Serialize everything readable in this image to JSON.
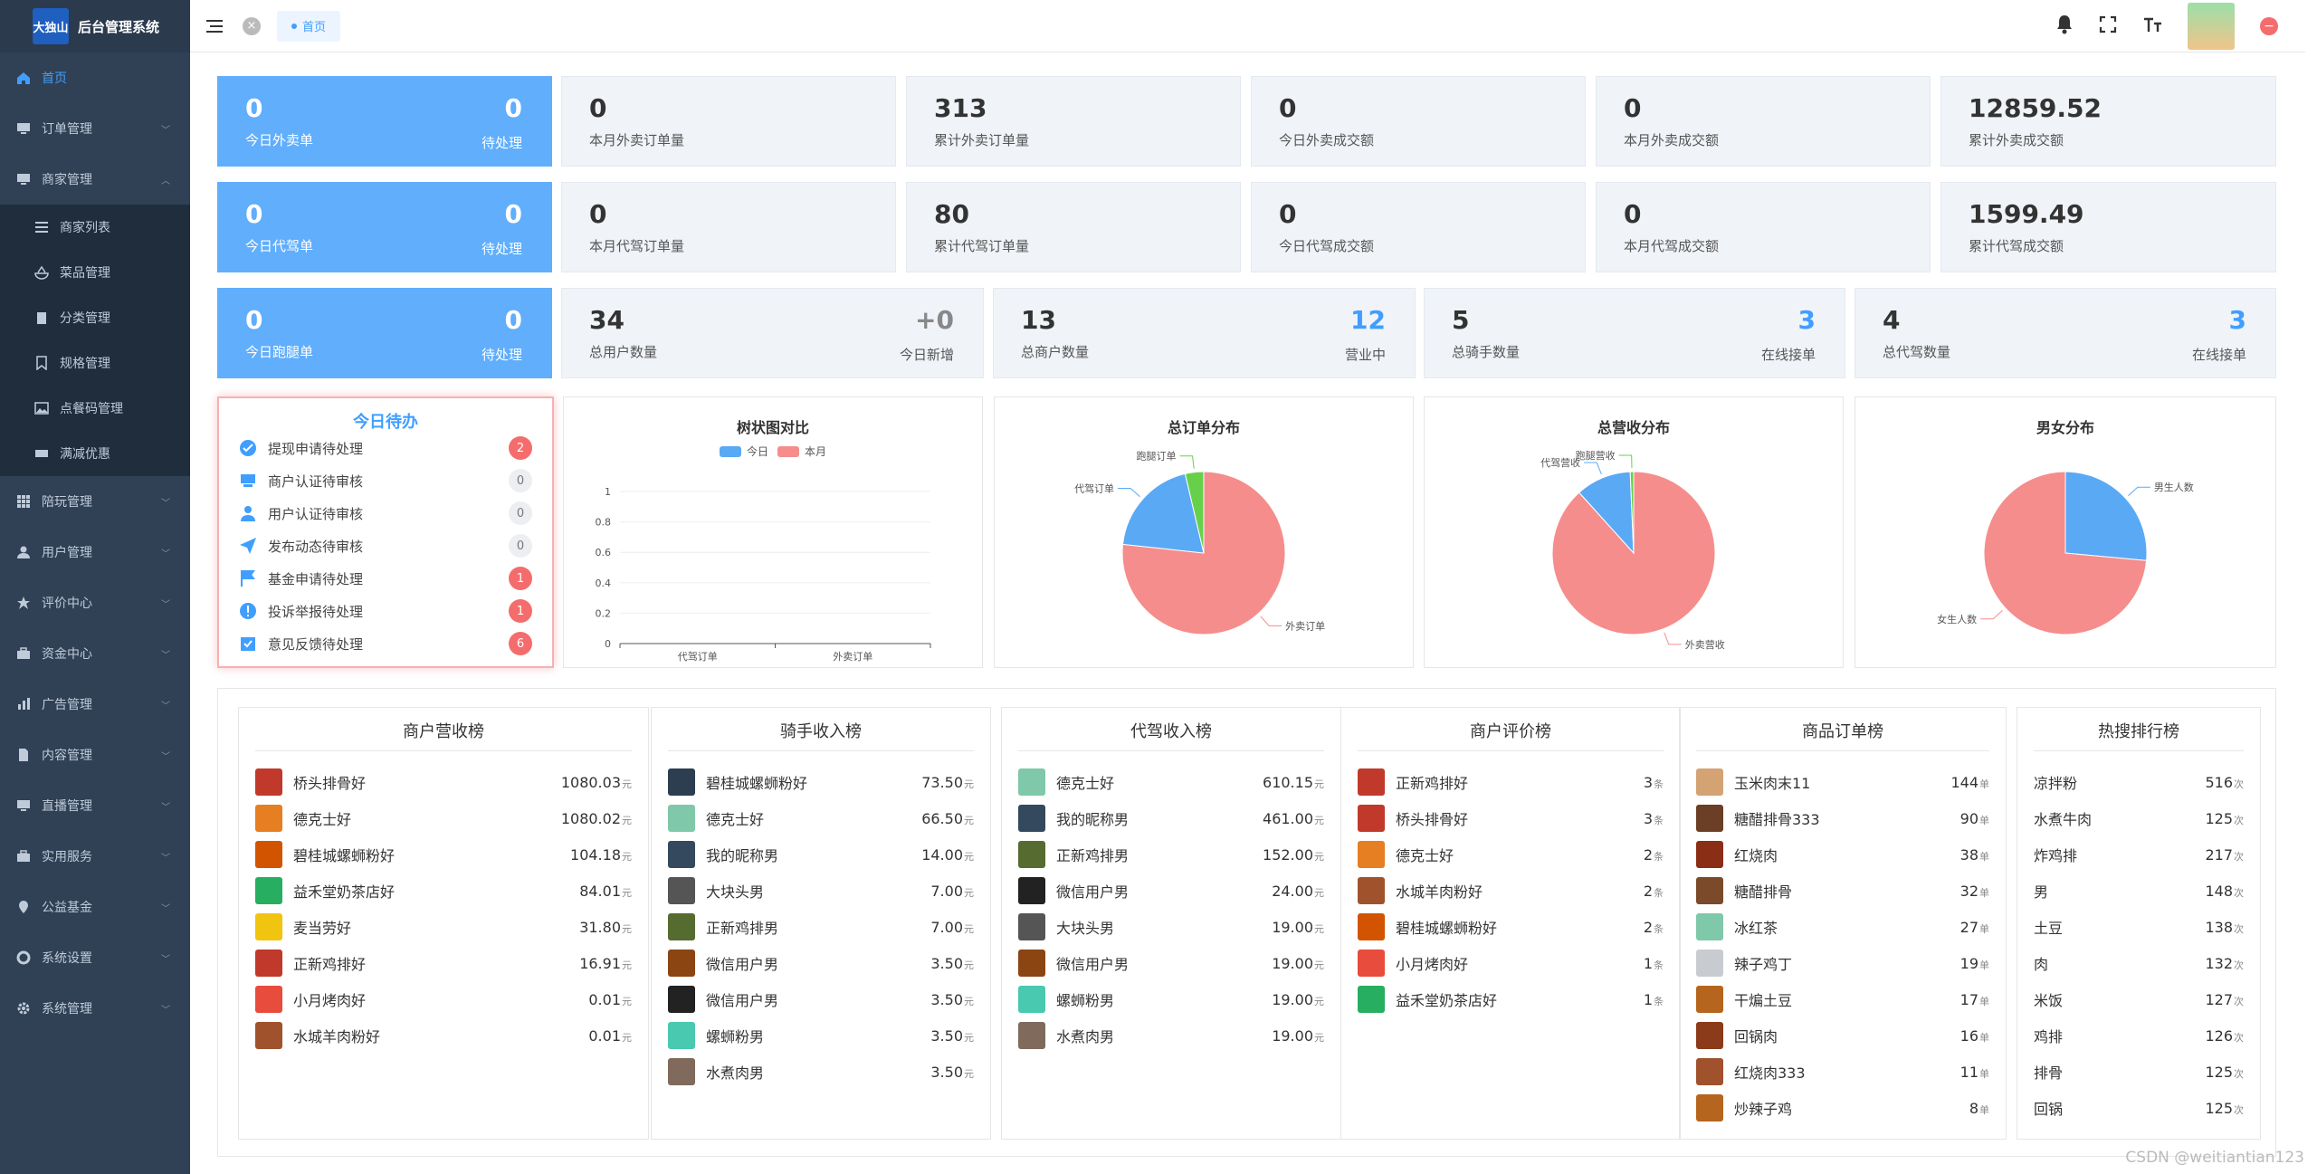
{
  "app": {
    "logo_text": "大独山",
    "title": "后台管理系统"
  },
  "sidebar": {
    "items": [
      {
        "label": "首页",
        "icon": "home-icon",
        "active": true
      },
      {
        "label": "订单管理",
        "icon": "monitor-icon"
      },
      {
        "label": "商家管理",
        "icon": "monitor-icon",
        "expanded": true
      },
      {
        "label": "陪玩管理",
        "icon": "grid-icon"
      },
      {
        "label": "用户管理",
        "icon": "user-icon"
      },
      {
        "label": "评价中心",
        "icon": "star-icon"
      },
      {
        "label": "资金中心",
        "icon": "briefcase-icon"
      },
      {
        "label": "广告管理",
        "icon": "chart-icon"
      },
      {
        "label": "内容管理",
        "icon": "document-icon"
      },
      {
        "label": "直播管理",
        "icon": "monitor-icon"
      },
      {
        "label": "实用服务",
        "icon": "briefcase-icon"
      },
      {
        "label": "公益基金",
        "icon": "location-icon"
      },
      {
        "label": "系统设置",
        "icon": "settings-icon"
      },
      {
        "label": "系统管理",
        "icon": "gear-icon"
      }
    ],
    "sub_items": [
      {
        "label": "商家列表",
        "icon": "list-icon"
      },
      {
        "label": "菜品管理",
        "icon": "bowl-icon"
      },
      {
        "label": "分类管理",
        "icon": "clipboard-icon"
      },
      {
        "label": "规格管理",
        "icon": "bookmark-icon"
      },
      {
        "label": "点餐码管理",
        "icon": "image-icon"
      },
      {
        "label": "满减优惠",
        "icon": "ticket-icon"
      }
    ]
  },
  "topbar": {
    "tab": "首页",
    "close": "×",
    "exit": "−"
  },
  "stats_row1": [
    {
      "value": "0",
      "label": "今日外卖单",
      "rvalue": "0",
      "rlabel": "待处理"
    },
    {
      "value": "0",
      "label": "本月外卖订单量"
    },
    {
      "value": "313",
      "label": "累计外卖订单量"
    },
    {
      "value": "0",
      "label": "今日外卖成交额"
    },
    {
      "value": "0",
      "label": "本月外卖成交额"
    },
    {
      "value": "12859.52",
      "label": "累计外卖成交额"
    }
  ],
  "stats_row2": [
    {
      "value": "0",
      "label": "今日代驾单",
      "rvalue": "0",
      "rlabel": "待处理"
    },
    {
      "value": "0",
      "label": "本月代驾订单量"
    },
    {
      "value": "80",
      "label": "累计代驾订单量"
    },
    {
      "value": "0",
      "label": "今日代驾成交额"
    },
    {
      "value": "0",
      "label": "本月代驾成交额"
    },
    {
      "value": "1599.49",
      "label": "累计代驾成交额"
    }
  ],
  "stats_row3": [
    {
      "value": "0",
      "label": "今日跑腿单",
      "rvalue": "0",
      "rlabel": "待处理"
    },
    {
      "value": "34",
      "label": "总用户数量",
      "rvalue": "+0",
      "rlabel": "今日新增"
    },
    {
      "value": "13",
      "label": "总商户数量",
      "rvalue": "12",
      "rlabel": "营业中"
    },
    {
      "value": "5",
      "label": "总骑手数量",
      "rvalue": "3",
      "rlabel": "在线接单"
    },
    {
      "value": "4",
      "label": "总代驾数量",
      "rvalue": "3",
      "rlabel": "在线接单"
    }
  ],
  "todo": {
    "title": "今日待办",
    "items": [
      {
        "label": "提现申请待处理",
        "count": "2",
        "icon": "check-circle-icon"
      },
      {
        "label": "商户认证待审核",
        "count": "0",
        "icon": "shop-icon"
      },
      {
        "label": "用户认证待审核",
        "count": "0",
        "icon": "user-icon"
      },
      {
        "label": "发布动态待审核",
        "count": "0",
        "icon": "send-icon"
      },
      {
        "label": "基金申请待处理",
        "count": "1",
        "icon": "flag-icon"
      },
      {
        "label": "投诉举报待处理",
        "count": "1",
        "icon": "alert-icon"
      },
      {
        "label": "意见反馈待处理",
        "count": "6",
        "icon": "feedback-icon"
      }
    ]
  },
  "chart_data": [
    {
      "type": "bar",
      "title": "树状图对比",
      "categories": [
        "代驾订单",
        "外卖订单"
      ],
      "series": [
        {
          "name": "今日",
          "values": [
            0,
            0
          ],
          "color": "#5aa9f5"
        },
        {
          "name": "本月",
          "values": [
            0,
            0
          ],
          "color": "#f58d8d"
        }
      ],
      "ylim": [
        0,
        1
      ],
      "yticks": [
        "0",
        "0.2",
        "0.4",
        "0.6",
        "0.8",
        "1"
      ],
      "legend": "top"
    },
    {
      "type": "pie",
      "title": "总订单分布",
      "labels": [
        "外卖订单",
        "代驾订单",
        "跑腿订单"
      ],
      "values": [
        313,
        80,
        15
      ],
      "colors": [
        "#f58d8d",
        "#5aa9f5",
        "#67d04a"
      ]
    },
    {
      "type": "pie",
      "title": "总营收分布",
      "labels": [
        "外卖营收",
        "代驾营收",
        "跑腿营收"
      ],
      "values": [
        12859.52,
        1599.49,
        100
      ],
      "colors": [
        "#f58d8d",
        "#5aa9f5",
        "#67d04a"
      ]
    },
    {
      "type": "pie",
      "title": "男女分布",
      "labels": [
        "男生人数",
        "女生人数"
      ],
      "values": [
        9,
        25
      ],
      "colors": [
        "#5aa9f5",
        "#f58d8d"
      ]
    }
  ],
  "rankings": [
    {
      "title": "商户营收榜",
      "unit": "元",
      "items": [
        {
          "name": "桥头排骨好",
          "value": "1080.03",
          "color": "#c0392b"
        },
        {
          "name": "德克士好",
          "value": "1080.02",
          "color": "#e67e22"
        },
        {
          "name": "碧桂城螺蛳粉好",
          "value": "104.18",
          "color": "#d35400"
        },
        {
          "name": "益禾堂奶茶店好",
          "value": "84.01",
          "color": "#27ae60"
        },
        {
          "name": "麦当劳好",
          "value": "31.80",
          "color": "#f1c40f"
        },
        {
          "name": "正新鸡排好",
          "value": "16.91",
          "color": "#c0392b"
        },
        {
          "name": "小月烤肉好",
          "value": "0.01",
          "color": "#e74c3c"
        },
        {
          "name": "水城羊肉粉好",
          "value": "0.01",
          "color": "#a0522d"
        }
      ]
    },
    {
      "title": "骑手收入榜",
      "unit": "元",
      "items": [
        {
          "name": "碧桂城螺蛳粉好",
          "value": "73.50",
          "color": "#2c3e50"
        },
        {
          "name": "德克士好",
          "value": "66.50",
          "color": "#7fc8a9"
        },
        {
          "name": "我的昵称男",
          "value": "14.00",
          "color": "#34495e"
        },
        {
          "name": "大块头男",
          "value": "7.00",
          "color": "#555"
        },
        {
          "name": "正新鸡排男",
          "value": "7.00",
          "color": "#556b2f"
        },
        {
          "name": "微信用户男",
          "value": "3.50",
          "color": "#8b4513"
        },
        {
          "name": "微信用户男",
          "value": "3.50",
          "color": "#222"
        },
        {
          "name": "螺蛳粉男",
          "value": "3.50",
          "color": "#48c9b0"
        },
        {
          "name": "水煮肉男",
          "value": "3.50",
          "color": "#7f6a5c"
        }
      ]
    },
    {
      "title": "代驾收入榜",
      "unit": "元",
      "items": [
        {
          "name": "德克士好",
          "value": "610.15",
          "color": "#7fc8a9"
        },
        {
          "name": "我的昵称男",
          "value": "461.00",
          "color": "#34495e"
        },
        {
          "name": "正新鸡排男",
          "value": "152.00",
          "color": "#556b2f"
        },
        {
          "name": "微信用户男",
          "value": "24.00",
          "color": "#222"
        },
        {
          "name": "大块头男",
          "value": "19.00",
          "color": "#555"
        },
        {
          "name": "微信用户男",
          "value": "19.00",
          "color": "#8b4513"
        },
        {
          "name": "螺蛳粉男",
          "value": "19.00",
          "color": "#48c9b0"
        },
        {
          "name": "水煮肉男",
          "value": "19.00",
          "color": "#7f6a5c"
        }
      ]
    },
    {
      "title": "商户评价榜",
      "unit": "条",
      "items": [
        {
          "name": "正新鸡排好",
          "value": "3",
          "color": "#c0392b"
        },
        {
          "name": "桥头排骨好",
          "value": "3",
          "color": "#c0392b"
        },
        {
          "name": "德克士好",
          "value": "2",
          "color": "#e67e22"
        },
        {
          "name": "水城羊肉粉好",
          "value": "2",
          "color": "#a0522d"
        },
        {
          "name": "碧桂城螺蛳粉好",
          "value": "2",
          "color": "#d35400"
        },
        {
          "name": "小月烤肉好",
          "value": "1",
          "color": "#e74c3c"
        },
        {
          "name": "益禾堂奶茶店好",
          "value": "1",
          "color": "#27ae60"
        }
      ]
    },
    {
      "title": "商品订单榜",
      "unit": "单",
      "items": [
        {
          "name": "玉米肉末11",
          "value": "144",
          "color": "#d4a373"
        },
        {
          "name": "糖醋排骨333",
          "value": "90",
          "color": "#6b3e26"
        },
        {
          "name": "红烧肉",
          "value": "38",
          "color": "#8b2e16"
        },
        {
          "name": "糖醋排骨",
          "value": "32",
          "color": "#7a4a2a"
        },
        {
          "name": "冰红茶",
          "value": "27",
          "color": "#7fc8a9"
        },
        {
          "name": "辣子鸡丁",
          "value": "19",
          "color": "#c8ccd0"
        },
        {
          "name": "干煸土豆",
          "value": "17",
          "color": "#b5651d"
        },
        {
          "name": "回锅肉",
          "value": "16",
          "color": "#8b3a1a"
        },
        {
          "name": "红烧肉333",
          "value": "11",
          "color": "#a0522d"
        },
        {
          "name": "炒辣子鸡",
          "value": "8",
          "color": "#b5651d"
        }
      ]
    },
    {
      "title": "热搜排行榜",
      "unit": "次",
      "items": [
        {
          "name": "凉拌粉",
          "value": "516"
        },
        {
          "name": "水煮牛肉",
          "value": "125"
        },
        {
          "name": "炸鸡排",
          "value": "217"
        },
        {
          "name": "男",
          "value": "148"
        },
        {
          "name": "土豆",
          "value": "138"
        },
        {
          "name": "肉",
          "value": "132"
        },
        {
          "name": "米饭",
          "value": "127"
        },
        {
          "name": "鸡排",
          "value": "126"
        },
        {
          "name": "排骨",
          "value": "125"
        },
        {
          "name": "回锅",
          "value": "125"
        }
      ]
    }
  ],
  "watermark": "CSDN @weitiantian123"
}
